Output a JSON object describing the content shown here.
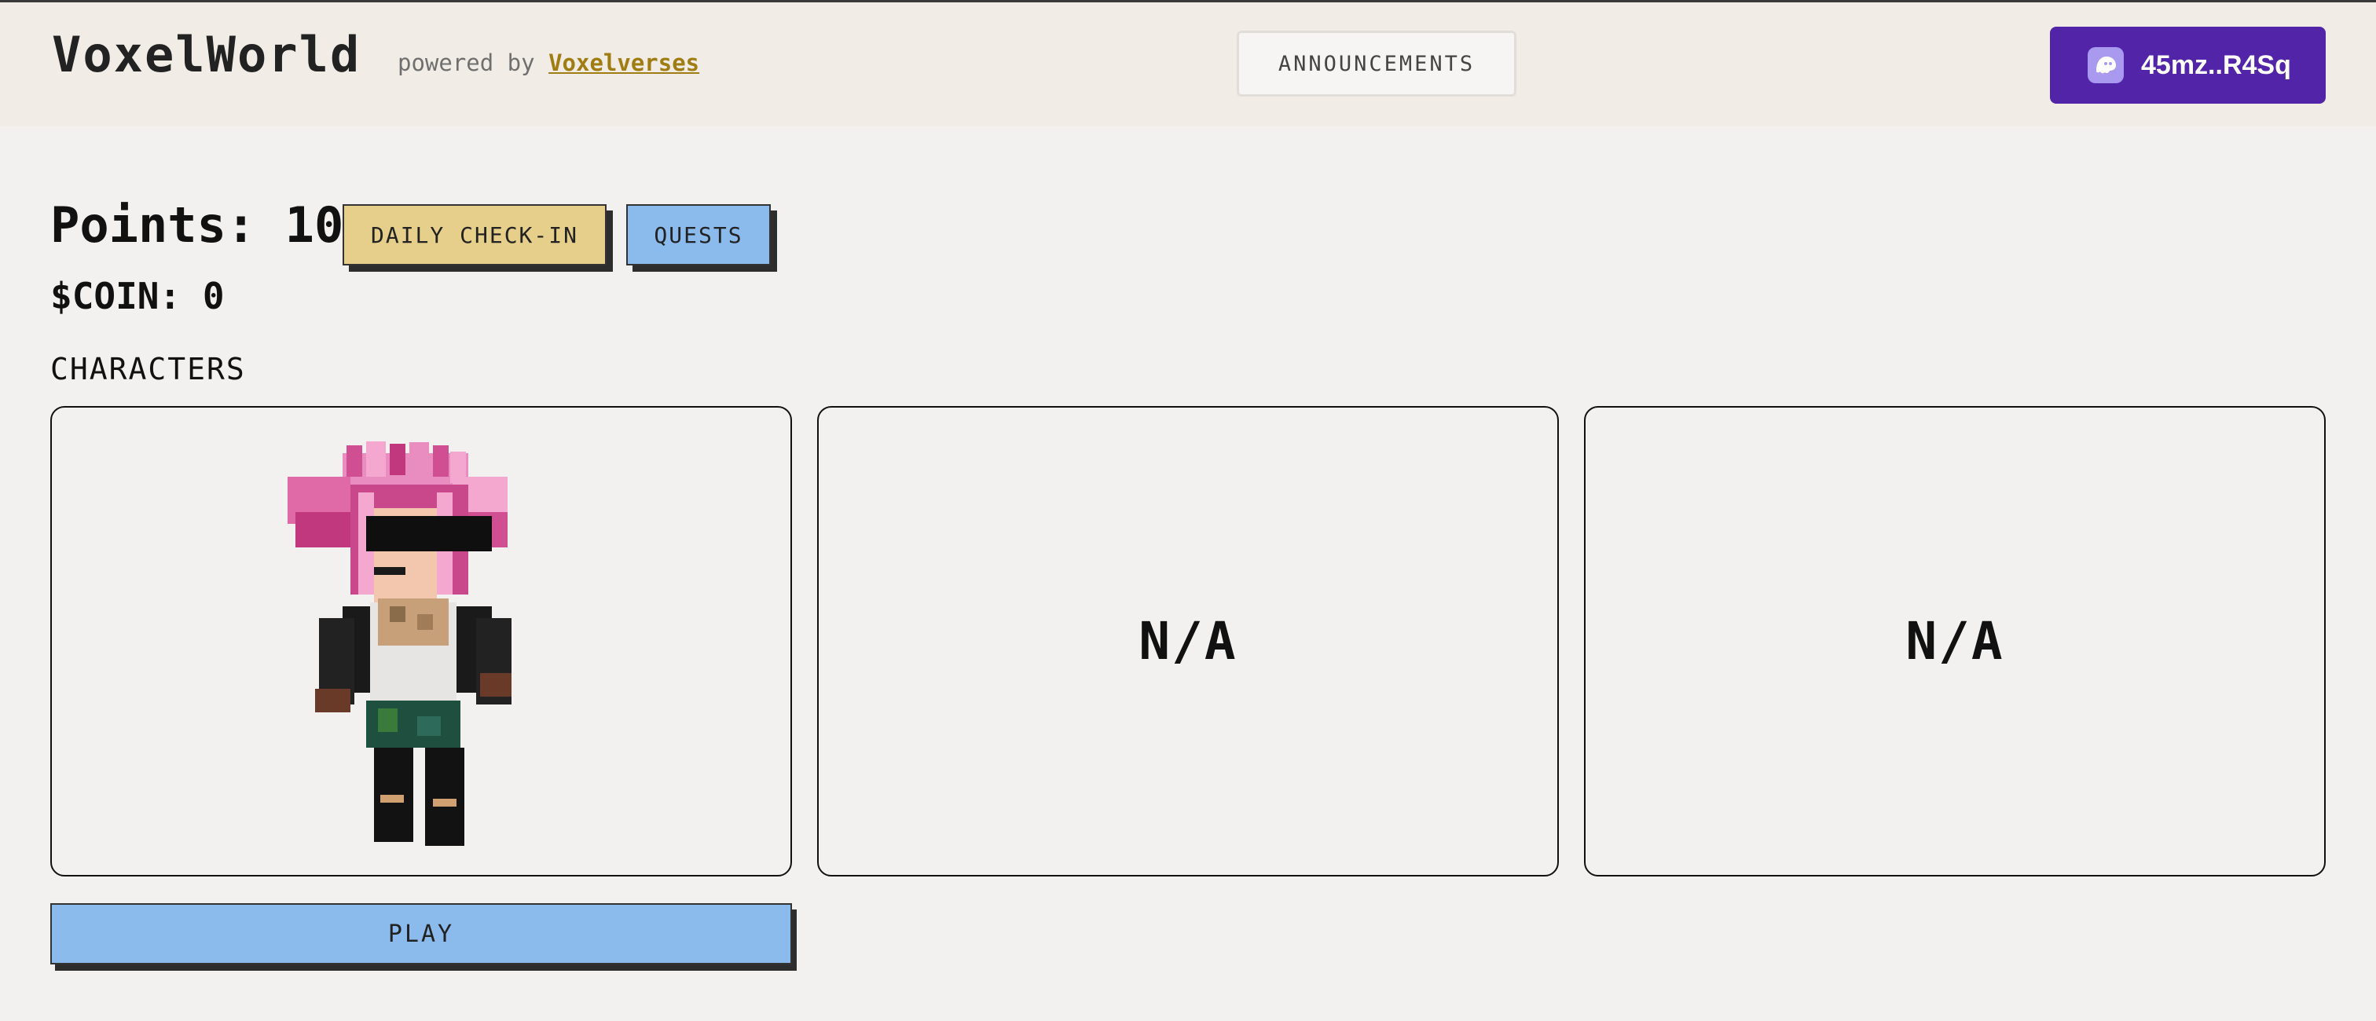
{
  "header": {
    "brand": "VoxelWorld",
    "powered_prefix": "powered by",
    "powered_link": "Voxelverses",
    "announcements_label": "ANNOUNCEMENTS",
    "wallet": {
      "address": "45mz..R4Sq",
      "icon": "phantom-ghost-icon",
      "color": "#5224a8"
    }
  },
  "stats": {
    "points": "Points: 100",
    "coin": "$COIN: 0"
  },
  "actions": {
    "daily_checkin": "DAILY CHECK-IN",
    "quests": "QUESTS",
    "play": "PLAY"
  },
  "characters": {
    "label": "CHARACTERS",
    "slots": [
      {
        "type": "avatar",
        "name": "voxel-avatar-pink-hair"
      },
      {
        "type": "empty",
        "label": "N/A"
      },
      {
        "type": "empty",
        "label": "N/A"
      }
    ]
  },
  "colors": {
    "daily_checkin_bg": "#e6cf8b",
    "quests_bg": "#8bbbec",
    "play_bg": "#8bbbec",
    "link": "#a07d12"
  }
}
